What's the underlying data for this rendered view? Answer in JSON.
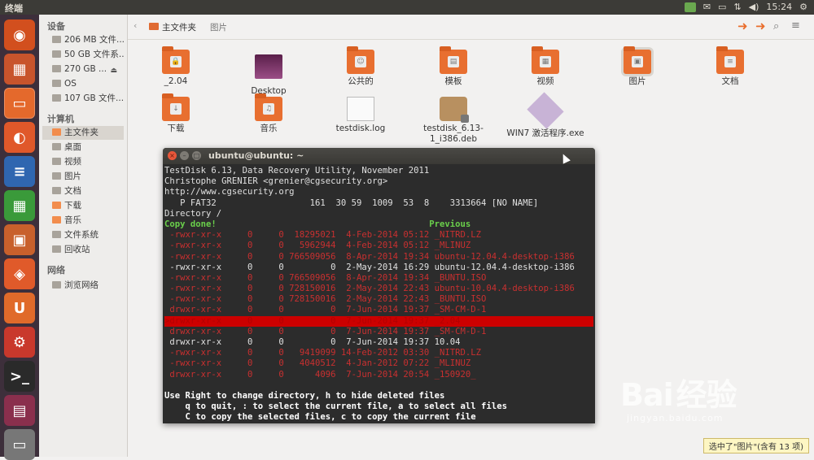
{
  "topbar": {
    "title": "终端",
    "clock": "15:24"
  },
  "launcher": {
    "items": [
      {
        "name": "ubuntu-dash",
        "color": "#d24f1e",
        "glyph": "◉"
      },
      {
        "name": "software-center",
        "color": "#c8542c",
        "glyph": "▦"
      },
      {
        "name": "files",
        "color": "#e4692c",
        "glyph": "▭"
      },
      {
        "name": "firefox",
        "color": "#e0582a",
        "glyph": "◐"
      },
      {
        "name": "libreoffice-writer",
        "color": "#2f66b0",
        "glyph": "≡"
      },
      {
        "name": "libreoffice-calc",
        "color": "#3a9a3a",
        "glyph": "▦"
      },
      {
        "name": "libreoffice-impress",
        "color": "#c8602c",
        "glyph": "▣"
      },
      {
        "name": "software-store",
        "color": "#e05a2a",
        "glyph": "◈"
      },
      {
        "name": "ubuntu-one",
        "color": "#e06a2a",
        "glyph": "U"
      },
      {
        "name": "system-settings",
        "color": "#c9382c",
        "glyph": "⚙"
      },
      {
        "name": "terminal",
        "color": "#2a2a2a",
        "glyph": ">_"
      },
      {
        "name": "workspaces",
        "color": "#8a2f4d",
        "glyph": "▤"
      },
      {
        "name": "trash",
        "color": "#777777",
        "glyph": "▭"
      }
    ]
  },
  "sidebar": {
    "devices_label": "设备",
    "devices": [
      "206 MB 文件...",
      "50 GB 文件系...",
      "270 GB ...",
      "OS",
      "107 GB 文件..."
    ],
    "computer_label": "计算机",
    "places": [
      "主文件夹",
      "桌面",
      "视频",
      "图片",
      "文档",
      "下载",
      "音乐",
      "文件系统",
      "回收站"
    ],
    "network_label": "网络",
    "network": [
      "浏览网络"
    ]
  },
  "toolbar": {
    "crumb_current": "主文件夹",
    "crumb_next": "图片"
  },
  "files": [
    {
      "label": "_2.04"
    },
    {
      "label": "Desktop"
    },
    {
      "label": "公共的"
    },
    {
      "label": "模板"
    },
    {
      "label": "视频"
    },
    {
      "label": "图片"
    },
    {
      "label": "文档"
    },
    {
      "label": "下载"
    },
    {
      "label": "音乐"
    },
    {
      "label": "testdisk.log"
    },
    {
      "label": "testdisk_6.13-1_i386.deb"
    },
    {
      "label": "WIN7 激活程序.exe"
    }
  ],
  "terminal": {
    "title": "ubuntu@ubuntu: ~",
    "lines": [
      "TestDisk 6.13, Data Recovery Utility, November 2011",
      "Christophe GRENIER <grenier@cgsecurity.org>",
      "http://www.cgsecurity.org",
      "   P FAT32                  161  30 59  1009  53  8    3313664 [NO NAME]",
      "Directory /",
      "Copy done!                                         Previous",
      " -rwxr-xr-x     0     0  18295021  4-Feb-2014 05:12 _NITRD.LZ",
      " -rwxr-xr-x     0     0   5962944  4-Feb-2014 05:12 _MLINUZ",
      " -rwxr-xr-x     0     0 766509056  8-Apr-2014 19:34 ubuntu-12.04.4-desktop-i386",
      " -rwxr-xr-x     0     0         0  2-May-2014 16:29 ubuntu-12.04.4-desktop-i386",
      " -rwxr-xr-x     0     0 766509056  8-Apr-2014 19:34 _BUNTU.ISO",
      " -rwxr-xr-x     0     0 728150016  2-May-2014 22:43 ubuntu-10.04.4-desktop-i386",
      " -rwxr-xr-x     0     0 728150016  2-May-2014 22:43 _BUNTU.ISO",
      " drwxr-xr-x     0     0         0  7-Jun-2014 19:37 _SM-CM-D-1",
      ">drwxr-xr-x     0     0         0  7-Jun-2014 19:37 _2.04",
      " drwxr-xr-x     0     0         0  7-Jun-2014 19:37 _SM-CM-D-1",
      " drwxr-xr-x     0     0         0  7-Jun-2014 19:37 10.04",
      " -rwxr-xr-x     0     0   9419099 14-Feb-2012 03:30 _NITRD.LZ",
      " -rwxr-xr-x     0     0   4040512  4-Jan-2012 07:22 _MLINUZ",
      " drwxr-xr-x     0     0      4096  7-Jun-2014 20:54 _150920_",
      "",
      "Use Right to change directory, h to hide deleted files",
      "    q to quit, : to select the current file, a to select all files",
      "    C to copy the selected files, c to copy the current file"
    ]
  },
  "watermark": {
    "brand": "Bai",
    "brand2": "经验",
    "url": "jingyan.baidu.com"
  },
  "status": "选中了\"图片\"(含有 13 项)"
}
